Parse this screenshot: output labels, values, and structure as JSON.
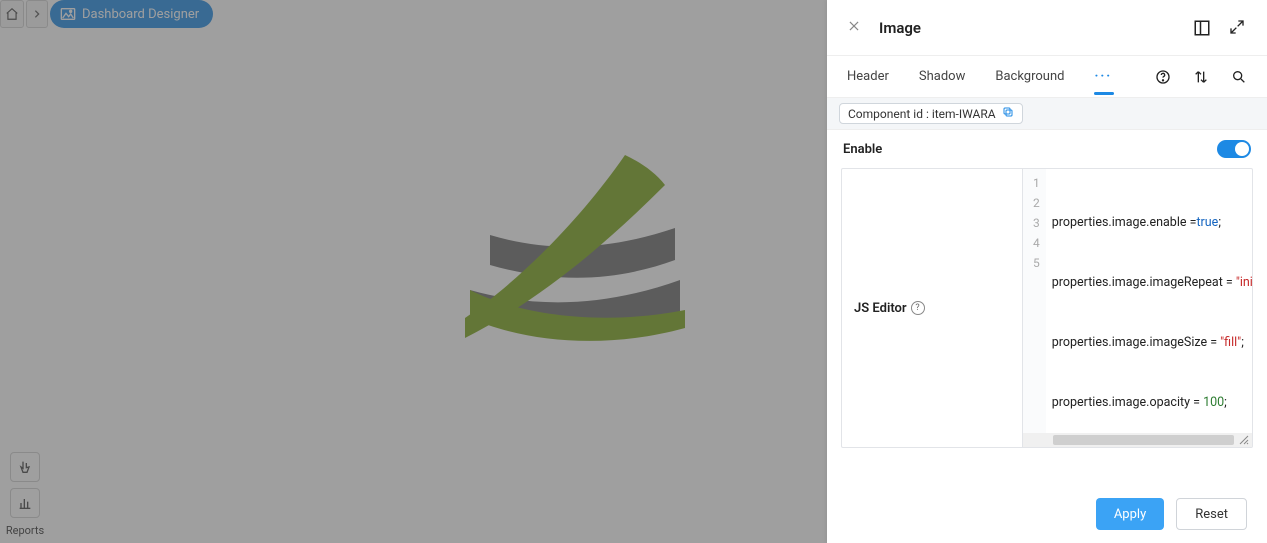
{
  "breadcrumb": {
    "page_label": "Dashboard Designer"
  },
  "left_tools": {
    "reports_label": "Reports"
  },
  "panel": {
    "title": "Image",
    "tabs": {
      "header": "Header",
      "shadow": "Shadow",
      "background": "Background",
      "more": "···"
    },
    "component_id_label": "Component id : item-IWARA",
    "enable_label": "Enable",
    "js_editor_label": "JS Editor",
    "apply_label": "Apply",
    "reset_label": "Reset",
    "code": {
      "l1_a": "properties.image.enable =",
      "l1_b": "true",
      "l1_c": ";",
      "l2_a": "properties.image.imageRepeat = ",
      "l2_b": "\"initia",
      "l3_a": "properties.image.imageSize = ",
      "l3_b": "\"fill\"",
      "l3_c": ";",
      "l4_a": "properties.image.opacity = ",
      "l4_b": "100",
      "l4_c": ";",
      "g1": "1",
      "g2": "2",
      "g3": "3",
      "g4": "4",
      "g5": "5"
    }
  }
}
